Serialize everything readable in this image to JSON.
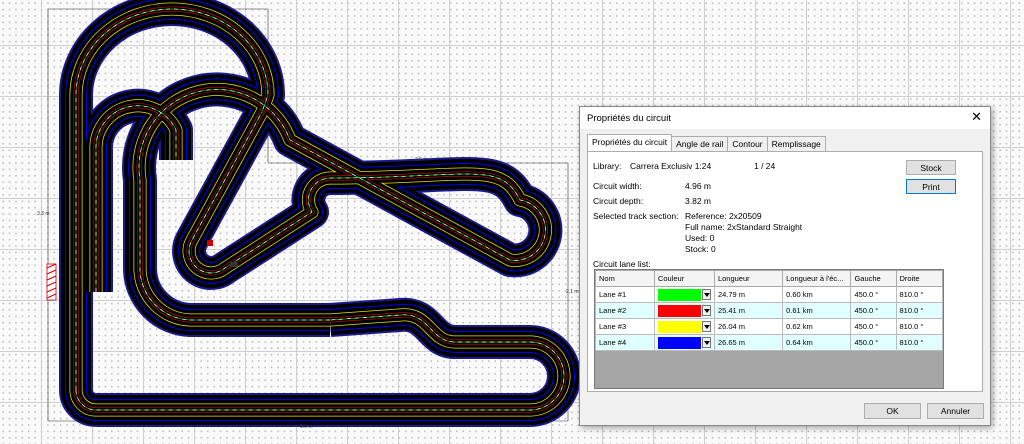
{
  "dialog": {
    "title": "Propriétés du circuit",
    "close_glyph": "✕",
    "tabs": [
      {
        "label": "Propriétés du circuit",
        "active": true
      },
      {
        "label": "Angle de rail"
      },
      {
        "label": "Contour"
      },
      {
        "label": "Remplissage"
      }
    ],
    "library_label": "Library:",
    "library_value": "Carrera Exclusiv 1:24",
    "scale_value": "1 / 24",
    "width_label": "Circuit width:",
    "width_value": "4.96 m",
    "depth_label": "Circuit depth:",
    "depth_value": "3.82 m",
    "section_label": "Selected track section:",
    "section": {
      "reference": "Reference: 2x20509",
      "full_name": "Full name: 2xStandard Straight",
      "used": "Used: 0",
      "stock": "Stock: 0"
    },
    "lane_list_label": "Circuit lane list:",
    "buttons": {
      "stock": "Stock",
      "print": "Print",
      "ok": "OK",
      "cancel": "Annuler"
    },
    "columns": [
      "Nom",
      "Couleur",
      "Longueur",
      "Longueur à l'éc...",
      "Gauche",
      "Droite"
    ],
    "lanes": [
      {
        "name": "Lane #1",
        "color": "#00ff00",
        "length": "24.79 m",
        "scale_length": "0.60 km",
        "left": "450.0 °",
        "right": "810.0 °"
      },
      {
        "name": "Lane #2",
        "color": "#ff0000",
        "length": "25.41 m",
        "scale_length": "0.61 km",
        "left": "450.0 °",
        "right": "810.0 °"
      },
      {
        "name": "Lane #3",
        "color": "#ffff00",
        "length": "26.04 m",
        "scale_length": "0.62 km",
        "left": "450.0 °",
        "right": "810.0 °"
      },
      {
        "name": "Lane #4",
        "color": "#0000ff",
        "length": "26.65 m",
        "scale_length": "0.64 km",
        "left": "450.0 °",
        "right": "810.0 °"
      }
    ]
  },
  "drawing": {
    "dim_width": "2.1 m",
    "dim_top_right": "1.8 m",
    "dim_side_left": "3.3 m",
    "dim_side_right": "2.1 m",
    "dim_bottom": "5.0 m",
    "dim_inner_top": "3.5 m",
    "track_color": "#000000",
    "border_color": "#1a1a8c",
    "lane_colors": [
      "#00ff00",
      "#ff0000",
      "#ffff00",
      "#0000ff"
    ]
  }
}
